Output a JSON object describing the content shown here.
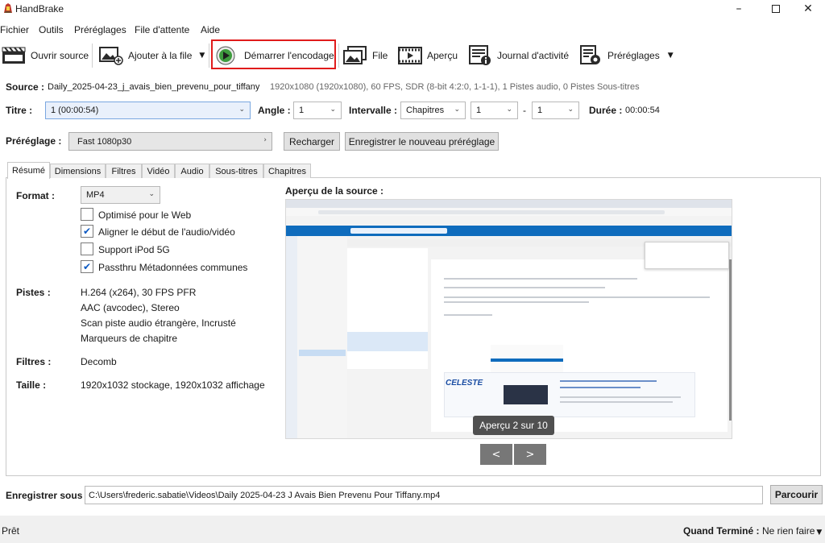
{
  "window": {
    "title": "HandBrake"
  },
  "menu": [
    "Fichier",
    "Outils",
    "Préréglages",
    "File d'attente",
    "Aide"
  ],
  "toolbar": {
    "open_source": "Ouvrir source",
    "add_queue": "Ajouter à la file",
    "start": "Démarrer l'encodage",
    "queue": "File",
    "preview": "Aperçu",
    "activity": "Journal d'activité",
    "presets": "Préréglages"
  },
  "source": {
    "label": "Source :",
    "name": "Daily_2025-04-23_j_avais_bien_prevenu_pour_tiffany",
    "info": "1920x1080 (1920x1080), 60 FPS, SDR (8-bit 4:2:0, 1-1-1), 1 Pistes audio, 0 Pistes Sous-titres"
  },
  "title_row": {
    "title_label": "Titre :",
    "title_value": "1 (00:00:54)",
    "angle_label": "Angle :",
    "angle_value": "1",
    "range_label": "Intervalle :",
    "range_type": "Chapitres",
    "range_start": "1",
    "range_sep": "-",
    "range_end": "1",
    "duration_label": "Durée :",
    "duration_value": "00:00:54"
  },
  "preset": {
    "label": "Préréglage :",
    "value": "Fast 1080p30",
    "reload": "Recharger",
    "save_new": "Enregistrer le nouveau préréglage"
  },
  "tabs": [
    "Résumé",
    "Dimensions",
    "Filtres",
    "Vidéo",
    "Audio",
    "Sous-titres",
    "Chapitres"
  ],
  "summary": {
    "format_label": "Format :",
    "format_value": "MP4",
    "options": [
      {
        "label": "Optimisé pour le Web",
        "checked": false
      },
      {
        "label": "Aligner le début de l'audio/vidéo",
        "checked": true
      },
      {
        "label": "Support iPod 5G",
        "checked": false
      },
      {
        "label": "Passthru Métadonnées communes",
        "checked": true
      }
    ],
    "tracks_label": "Pistes :",
    "tracks": [
      "H.264 (x264), 30 FPS PFR",
      "AAC (avcodec), Stereo",
      "Scan piste audio étrangère, Incrusté",
      "Marqueurs de chapitre"
    ],
    "filters_label": "Filtres :",
    "filters_value": "Decomb",
    "size_label": "Taille :",
    "size_value": "1920x1032 stockage, 1920x1032 affichage"
  },
  "preview": {
    "heading": "Aperçu de la source :",
    "badge": "Aperçu 2 sur 10",
    "prev": "<",
    "next": ">",
    "thumb_brand": "CELESTE"
  },
  "save": {
    "label": "Enregistrer sous :",
    "path": "C:\\Users\\frederic.sabatie\\Videos\\Daily 2025-04-23 J Avais Bien Prevenu Pour Tiffany.mp4",
    "browse": "Parcourir"
  },
  "status": {
    "text": "Prêt",
    "when_done_label": "Quand Terminé :",
    "when_done_value": "Ne rien faire"
  }
}
